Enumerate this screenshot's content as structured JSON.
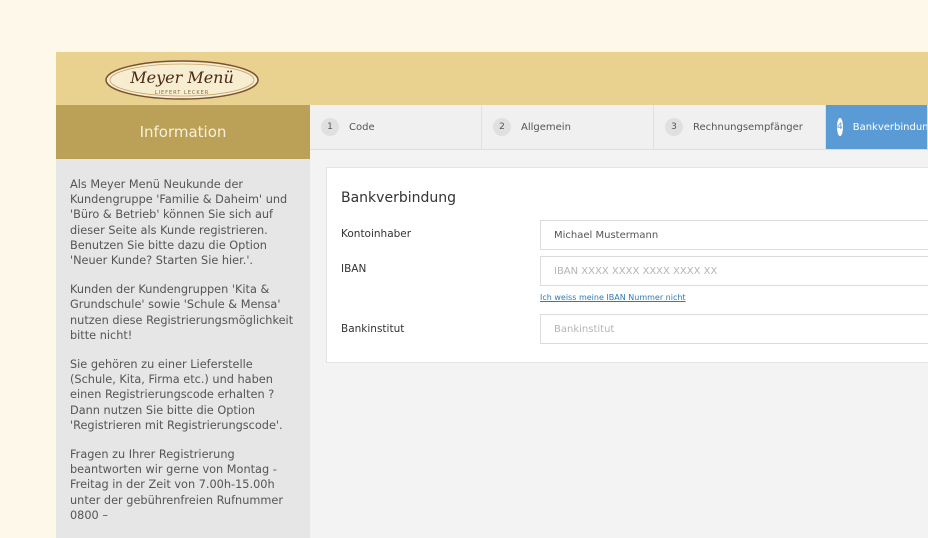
{
  "logo": {
    "brand": "Meyer Menü",
    "tagline": "LIEFERT LECKER"
  },
  "sidebar": {
    "title": "Information",
    "paragraphs": [
      "Als Meyer Menü Neukunde der Kundengruppe 'Familie & Daheim' und 'Büro & Betrieb' können Sie sich auf dieser Seite als Kunde registrieren. Benutzen Sie bitte dazu die Option 'Neuer Kunde? Starten Sie hier.'.",
      "Kunden der Kundengruppen 'Kita & Grundschule' sowie 'Schule & Mensa' nutzen diese Registrierungsmöglichkeit bitte nicht!",
      "Sie gehören zu einer Lieferstelle (Schule, Kita, Firma etc.) und haben einen Registrierungscode erhalten ? Dann nutzen Sie bitte die Option 'Registrieren mit Registrierungscode'.",
      "Fragen zu Ihrer Registrierung beantworten wir gerne von Montag - Freitag in der Zeit von 7.00h-15.00h unter der gebührenfreien Rufnummer 0800 –"
    ]
  },
  "steps": [
    {
      "num": "1",
      "label": "Code"
    },
    {
      "num": "2",
      "label": "Allgemein"
    },
    {
      "num": "3",
      "label": "Rechnungsempfänger"
    },
    {
      "num": "4",
      "label": "Bankverbindung"
    }
  ],
  "form": {
    "title": "Bankverbindung",
    "kontoinhaber_label": "Kontoinhaber",
    "kontoinhaber_value": "Michael Mustermann",
    "iban_label": "IBAN",
    "iban_placeholder": "IBAN XXXX XXXX XXXX XXXX XX",
    "iban_link": "Ich weiss meine IBAN Nummer nicht",
    "bank_label": "Bankinstitut",
    "bank_placeholder": "Bankinstitut"
  },
  "colors": {
    "accent": "#5b9bd5",
    "header": "#e9d28f",
    "sidebar_head": "#bba158",
    "link": "#2b7bbd"
  }
}
